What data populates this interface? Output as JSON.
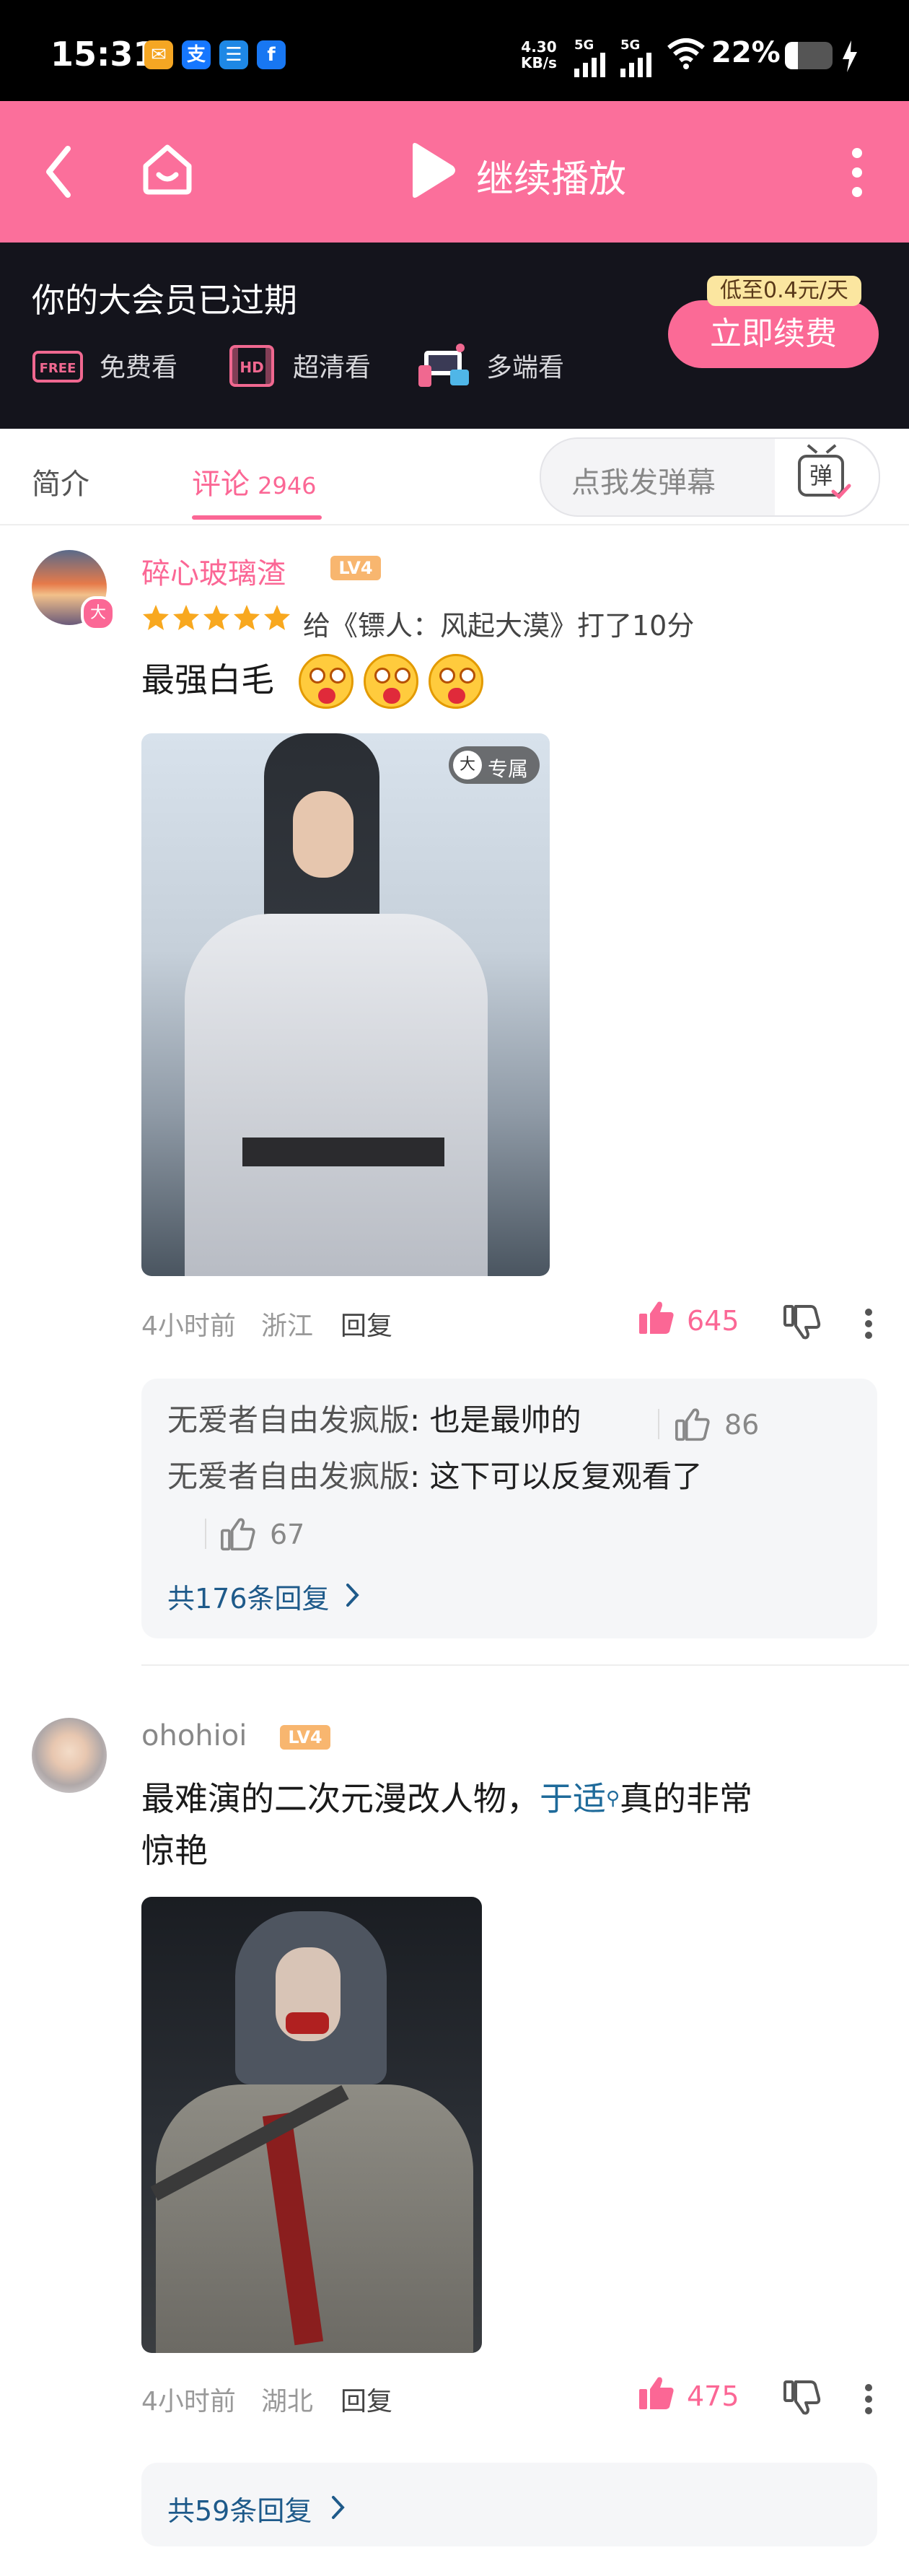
{
  "status_bar": {
    "time": "15:31",
    "net_speed_value": "4.30",
    "net_speed_unit": "KB/s",
    "signal1": "5G",
    "signal2": "5G",
    "battery": "22%",
    "app_icons": [
      "message-app-icon",
      "alipay-icon",
      "chat-app-icon",
      "facebook-icon"
    ]
  },
  "toolbar": {
    "title": "继续播放",
    "accent": "#fb6f9b"
  },
  "vip_banner": {
    "headline": "你的大会员已过期",
    "features": [
      {
        "badge": "FREE",
        "label": "免费看"
      },
      {
        "badge": "HD",
        "label": "超清看"
      },
      {
        "badge": "multi",
        "label": "多端看"
      }
    ],
    "price_tag": "低至0.4元/天",
    "renew_button": "立即续费"
  },
  "tabs": {
    "intro": "简介",
    "comments": "评论",
    "comment_count": "2946",
    "danmu_placeholder": "点我发弹幕",
    "danmu_button": "弹"
  },
  "comments": [
    {
      "username": "碎心玻璃渣",
      "level": "LV4",
      "rating_text": "给《镖人：风起大漠》打了10分",
      "stars": 5,
      "text": "最强白毛",
      "emoji_count": 3,
      "exclusive_label": "专属",
      "time": "4小时前",
      "location": "浙江",
      "reply_label": "回复",
      "likes": "645",
      "replies": [
        {
          "user": "无爱者自由发疯版",
          "text": ": 也是最帅的",
          "likes": "86"
        },
        {
          "user": "无爱者自由发疯版",
          "text": ": 这下可以反复观看了",
          "likes": "67"
        }
      ],
      "more_replies": "共176条回复"
    },
    {
      "username": "ohohioi",
      "level": "LV4",
      "text_prefix": "最难演的二次元漫改人物，",
      "link_text": "于适",
      "text_suffix_line1": "真的非常",
      "text_suffix_line2": "惊艳",
      "time": "4小时前",
      "location": "湖北",
      "reply_label": "回复",
      "likes": "475",
      "more_replies": "共59条回复"
    }
  ]
}
